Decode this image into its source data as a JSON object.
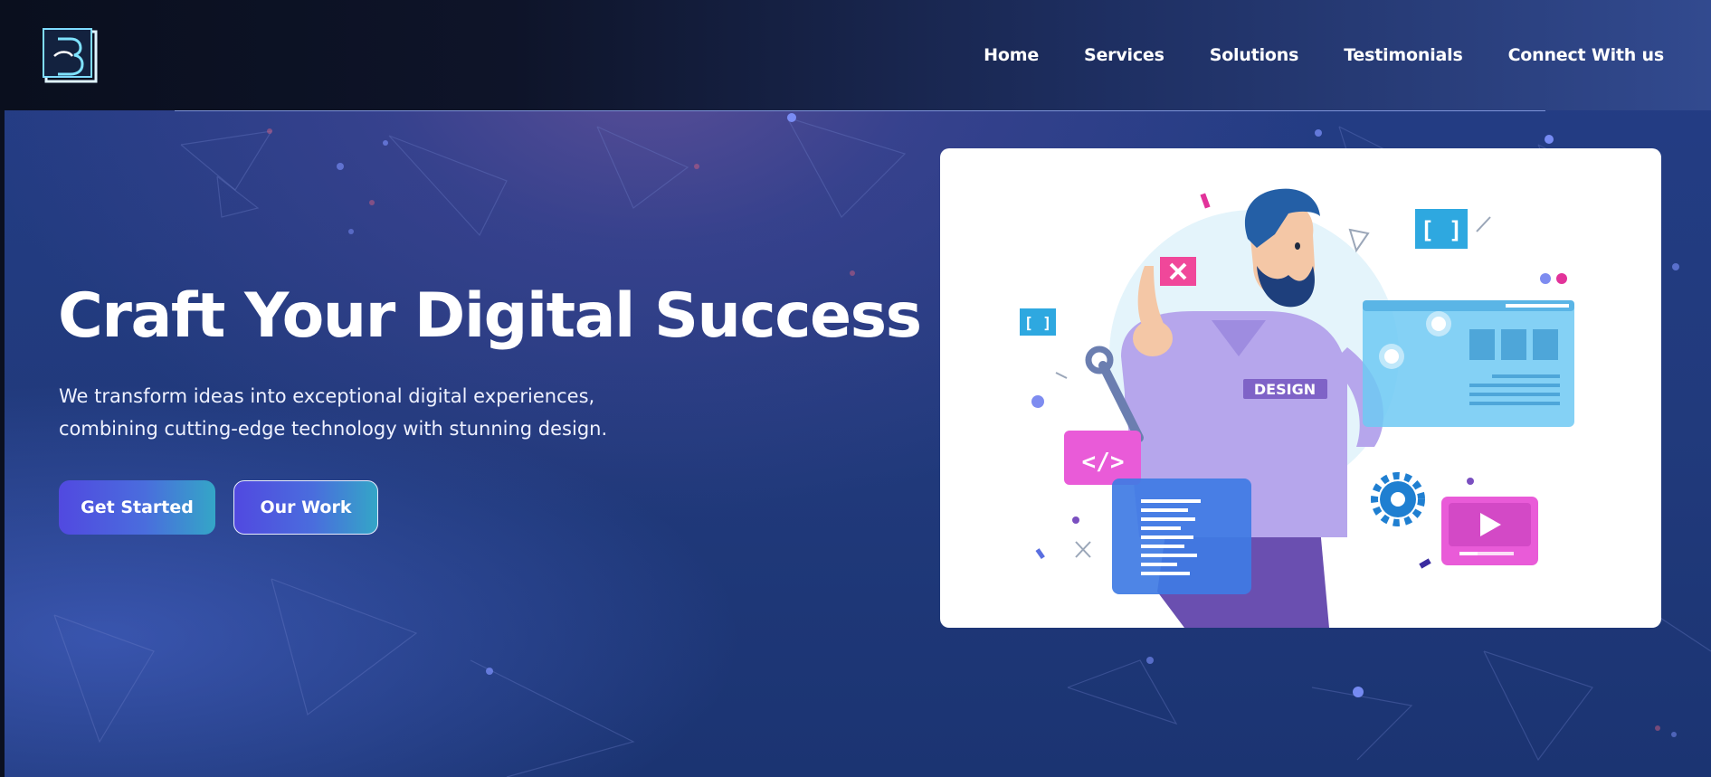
{
  "nav": {
    "items": [
      "Home",
      "Services",
      "Solutions",
      "Testimonials",
      "Connect With us"
    ]
  },
  "hero": {
    "title": "Craft Your Digital Success",
    "subtitle": "We transform ideas into exceptional digital experiences, combining cutting-edge technology with stunning design.",
    "primary_button": "Get Started",
    "secondary_button": "Our Work"
  },
  "illustration": {
    "shirt_text": "DESIGN"
  },
  "colors": {
    "accent_start": "#5149e0",
    "accent_end": "#34a6c7",
    "background": "#213a7c"
  }
}
